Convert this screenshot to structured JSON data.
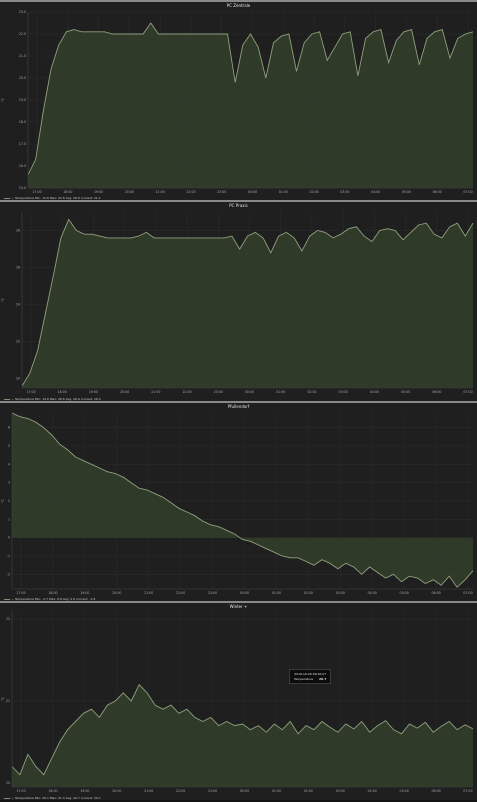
{
  "colors": {
    "line": "#8fa07c",
    "fill": "#33402b",
    "grid": "#2b2b2b",
    "bg": "#1f1f1f"
  },
  "x_ticks": [
    "17:00",
    "18:00",
    "19:00",
    "20:00",
    "21:00",
    "22:00",
    "23:00",
    "00:00",
    "01:00",
    "02:00",
    "03:00",
    "04:00",
    "05:00",
    "06:00",
    "07:00"
  ],
  "panels": [
    {
      "title": "PC Zentrale",
      "legend": "— Temperature  Min: 15.6  Max: 22.6  Avg: 20.8  Current: 21.1",
      "ylabel": "°C",
      "chart_data": {
        "type": "area",
        "yticks": [
          "15.0",
          "16.0",
          "17.0",
          "18.0",
          "19.0",
          "20.0",
          "21.0",
          "22.0",
          "23.0"
        ],
        "ylim": [
          15,
          23
        ],
        "values": [
          15.6,
          16.3,
          18.5,
          20.4,
          21.5,
          22.1,
          22.2,
          22.1,
          22.1,
          22.1,
          22.1,
          22.0,
          22.0,
          22.0,
          22.0,
          22.0,
          22.5,
          22.0,
          22.0,
          22.0,
          22.0,
          22.0,
          22.0,
          22.0,
          22.0,
          22.0,
          22.0,
          19.8,
          21.5,
          22.0,
          21.4,
          20.0,
          21.6,
          21.9,
          22.0,
          20.3,
          21.6,
          22.0,
          22.1,
          20.8,
          21.4,
          22.0,
          22.1,
          20.1,
          21.8,
          22.1,
          22.2,
          20.7,
          21.7,
          22.1,
          22.2,
          20.6,
          21.8,
          22.1,
          22.2,
          20.9,
          21.8,
          22.0,
          22.1
        ]
      }
    },
    {
      "title": "PC Praxis",
      "legend": "— Temperature  Min: 19.6  Max: 28.6  Avg: 26.9  Current: 28.4",
      "ylabel": "°C",
      "chart_data": {
        "type": "area",
        "yticks": [
          "20",
          "22",
          "24",
          "26",
          "28"
        ],
        "ylim": [
          19.5,
          29
        ],
        "values": [
          19.6,
          20.3,
          21.5,
          23.5,
          25.5,
          27.6,
          28.6,
          28.0,
          27.8,
          27.8,
          27.7,
          27.6,
          27.6,
          27.6,
          27.6,
          27.7,
          27.9,
          27.6,
          27.6,
          27.6,
          27.6,
          27.6,
          27.6,
          27.6,
          27.6,
          27.6,
          27.6,
          27.7,
          27.0,
          27.7,
          27.9,
          27.6,
          26.8,
          27.7,
          27.9,
          27.6,
          26.9,
          27.7,
          28.0,
          27.9,
          27.6,
          27.8,
          28.1,
          28.2,
          27.7,
          27.4,
          28.0,
          28.1,
          28.0,
          27.5,
          27.9,
          28.3,
          28.4,
          27.8,
          27.6,
          28.2,
          28.4,
          27.7,
          28.4
        ]
      }
    },
    {
      "title": "Pfullendorf",
      "legend": "— Temperature  Min: -2.7  Max: 6.8  Avg: 2.6  Current: -1.8",
      "ylabel": "°C",
      "chart_data": {
        "type": "area",
        "yticks": [
          "-2",
          "-1",
          "0",
          "1",
          "2",
          "3",
          "4",
          "5",
          "6"
        ],
        "ylim": [
          -2.8,
          6.8
        ],
        "values": [
          6.8,
          6.6,
          6.5,
          6.3,
          6.0,
          5.6,
          5.1,
          4.8,
          4.4,
          4.2,
          4.0,
          3.8,
          3.6,
          3.5,
          3.3,
          3.0,
          2.7,
          2.6,
          2.4,
          2.2,
          1.9,
          1.6,
          1.4,
          1.2,
          0.9,
          0.7,
          0.6,
          0.4,
          0.2,
          -0.1,
          -0.2,
          -0.4,
          -0.6,
          -0.8,
          -1.0,
          -1.1,
          -1.1,
          -1.3,
          -1.5,
          -1.2,
          -1.4,
          -1.7,
          -1.4,
          -1.6,
          -2.0,
          -1.6,
          -1.9,
          -2.2,
          -2.0,
          -2.4,
          -2.1,
          -2.2,
          -2.5,
          -2.3,
          -2.6,
          -2.1,
          -2.7,
          -2.3,
          -1.8
        ]
      }
    },
    {
      "title": "Winter +",
      "legend": "— Temperature  Min: 20.1  Max: 21.3  Avg: 20.7  Current: 20.7",
      "ylabel": "°C",
      "tooltip": {
        "time": "2019-10-26 09:10:07",
        "label": "Temperature",
        "value": "20.7"
      },
      "chart_data": {
        "type": "area",
        "yticks": [
          "20",
          "21",
          "22"
        ],
        "ylim": [
          19.95,
          22.1
        ],
        "values": [
          20.2,
          20.1,
          20.35,
          20.2,
          20.1,
          20.3,
          20.5,
          20.65,
          20.75,
          20.85,
          20.9,
          20.8,
          20.95,
          21.0,
          21.1,
          21.0,
          21.2,
          21.1,
          20.95,
          20.9,
          20.95,
          20.85,
          20.9,
          20.8,
          20.75,
          20.8,
          20.7,
          20.75,
          20.7,
          20.72,
          20.65,
          20.7,
          20.62,
          20.72,
          20.65,
          20.75,
          20.6,
          20.7,
          20.65,
          20.75,
          20.68,
          20.62,
          20.72,
          20.66,
          20.75,
          20.62,
          20.7,
          20.76,
          20.65,
          20.6,
          20.72,
          20.67,
          20.74,
          20.62,
          20.69,
          20.75,
          20.65,
          20.71,
          20.66
        ]
      }
    }
  ]
}
